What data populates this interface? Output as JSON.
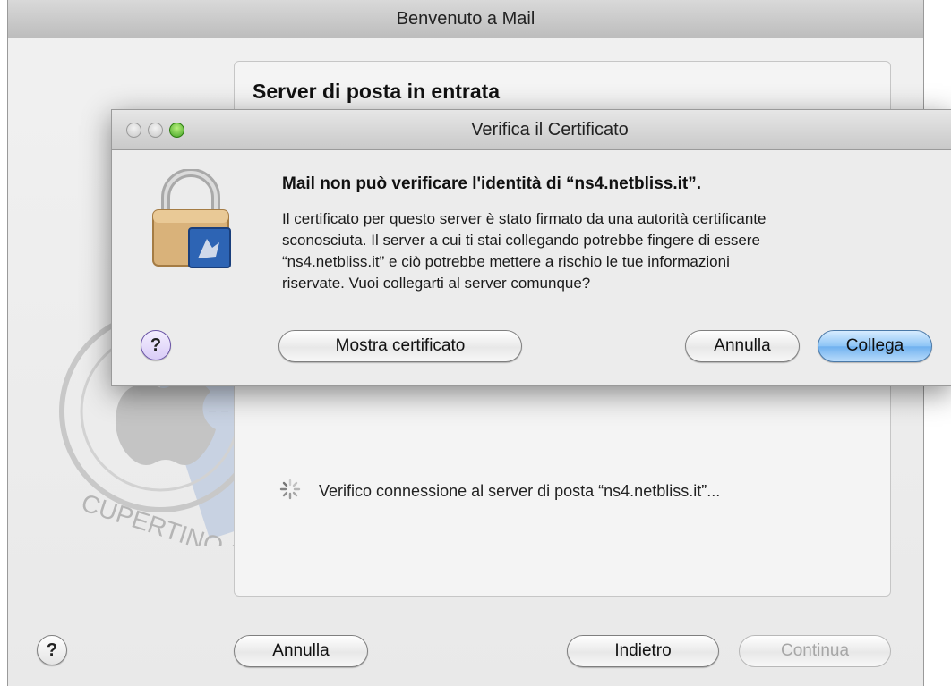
{
  "main_window": {
    "title": "Benvenuto a Mail",
    "panel_title": "Server di posta in entrata",
    "status": "Verifico connessione al server di posta “ns4.netbliss.it”...",
    "stamp_text": "CUPERTINO CA",
    "buttons": {
      "help": "?",
      "cancel": "Annulla",
      "back": "Indietro",
      "continue": "Continua"
    }
  },
  "dialog": {
    "title": "Verifica il Certificato",
    "heading": "Mail non può verificare l'identità di “ns4.netbliss.it”.",
    "body_lines": [
      "Il certificato per questo server è stato firmato da una autorità certificante",
      "sconosciuta. Il server a cui ti stai collegando potrebbe fingere di essere",
      "“ns4.netbliss.it” e ciò potrebbe mettere a rischio le tue informazioni",
      "riservate. Vuoi collegarti al server comunque?"
    ],
    "buttons": {
      "help": "?",
      "show_certificate": "Mostra certificato",
      "cancel": "Annulla",
      "connect": "Collega"
    }
  },
  "icons": {
    "lock": "lock-icon",
    "spinner": "spinner-icon",
    "stamp": "stamp-icon"
  }
}
